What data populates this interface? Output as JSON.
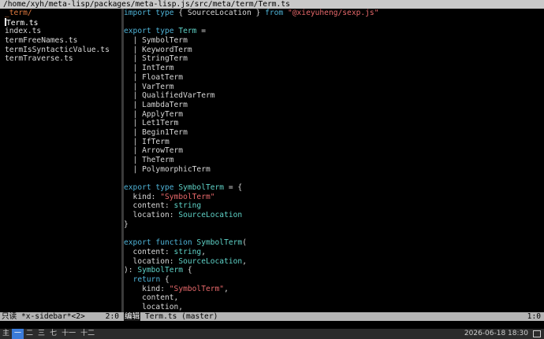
{
  "titlebar": {
    "path": "/home/xyh/meta-lisp/packages/meta-lisp.js/src/meta/term/Term.ts"
  },
  "sidebar": {
    "dir": "_term/",
    "files": [
      "Term.ts",
      "index.ts",
      "termFreeNames.ts",
      "termIsSyntacticValue.ts",
      "termTraverse.ts"
    ]
  },
  "editor": {
    "lines": [
      [
        {
          "c": "kw",
          "t": "import type"
        },
        {
          "c": "tx",
          "t": " { SourceLocation } "
        },
        {
          "c": "kw",
          "t": "from"
        },
        {
          "c": "tx",
          "t": " "
        },
        {
          "c": "str",
          "t": "\"@xieyuheng/sexp.js\""
        }
      ],
      [],
      [
        {
          "c": "kw",
          "t": "export type"
        },
        {
          "c": "tx",
          "t": " "
        },
        {
          "c": "ty",
          "t": "Term"
        },
        {
          "c": "tx",
          "t": " ="
        }
      ],
      [
        {
          "c": "tx",
          "t": "  | SymbolTerm"
        }
      ],
      [
        {
          "c": "tx",
          "t": "  | KeywordTerm"
        }
      ],
      [
        {
          "c": "tx",
          "t": "  | StringTerm"
        }
      ],
      [
        {
          "c": "tx",
          "t": "  | IntTerm"
        }
      ],
      [
        {
          "c": "tx",
          "t": "  | FloatTerm"
        }
      ],
      [
        {
          "c": "tx",
          "t": "  | VarTerm"
        }
      ],
      [
        {
          "c": "tx",
          "t": "  | QualifiedVarTerm"
        }
      ],
      [
        {
          "c": "tx",
          "t": "  | LambdaTerm"
        }
      ],
      [
        {
          "c": "tx",
          "t": "  | ApplyTerm"
        }
      ],
      [
        {
          "c": "tx",
          "t": "  | Let1Term"
        }
      ],
      [
        {
          "c": "tx",
          "t": "  | Begin1Term"
        }
      ],
      [
        {
          "c": "tx",
          "t": "  | IfTerm"
        }
      ],
      [
        {
          "c": "tx",
          "t": "  | ArrowTerm"
        }
      ],
      [
        {
          "c": "tx",
          "t": "  | TheTerm"
        }
      ],
      [
        {
          "c": "tx",
          "t": "  | PolymorphicTerm"
        }
      ],
      [],
      [
        {
          "c": "kw",
          "t": "export type"
        },
        {
          "c": "tx",
          "t": " "
        },
        {
          "c": "ty",
          "t": "SymbolTerm"
        },
        {
          "c": "tx",
          "t": " = {"
        }
      ],
      [
        {
          "c": "tx",
          "t": "  kind: "
        },
        {
          "c": "str",
          "t": "\"SymbolTerm\""
        }
      ],
      [
        {
          "c": "tx",
          "t": "  content: "
        },
        {
          "c": "ty",
          "t": "string"
        }
      ],
      [
        {
          "c": "tx",
          "t": "  location: "
        },
        {
          "c": "ty",
          "t": "SourceLocation"
        }
      ],
      [
        {
          "c": "tx",
          "t": "}"
        }
      ],
      [],
      [
        {
          "c": "kw",
          "t": "export function"
        },
        {
          "c": "tx",
          "t": " "
        },
        {
          "c": "ty",
          "t": "SymbolTerm"
        },
        {
          "c": "tx",
          "t": "("
        }
      ],
      [
        {
          "c": "tx",
          "t": "  content: "
        },
        {
          "c": "ty",
          "t": "string"
        },
        {
          "c": "tx",
          "t": ","
        }
      ],
      [
        {
          "c": "tx",
          "t": "  location: "
        },
        {
          "c": "ty",
          "t": "SourceLocation"
        },
        {
          "c": "tx",
          "t": ","
        }
      ],
      [
        {
          "c": "tx",
          "t": "): "
        },
        {
          "c": "ty",
          "t": "SymbolTerm"
        },
        {
          "c": "tx",
          "t": " {"
        }
      ],
      [
        {
          "c": "tx",
          "t": "  "
        },
        {
          "c": "kw",
          "t": "return"
        },
        {
          "c": "tx",
          "t": " {"
        }
      ],
      [
        {
          "c": "tx",
          "t": "    kind: "
        },
        {
          "c": "str",
          "t": "\"SymbolTerm\""
        },
        {
          "c": "tx",
          "t": ","
        }
      ],
      [
        {
          "c": "tx",
          "t": "    content,"
        }
      ],
      [
        {
          "c": "tx",
          "t": "    location,"
        }
      ]
    ]
  },
  "modeline_left": {
    "status": "只读",
    "buffer": "*x-sidebar*<2>",
    "pos": "2:0"
  },
  "modeline_right": {
    "badge": "编辑",
    "buffer": "Term.ts (master)",
    "pos": "1:0"
  },
  "taskbar": {
    "workspaces": [
      "主",
      "一",
      "二",
      "三",
      "七",
      "十一",
      "十二"
    ],
    "active_index": 1,
    "clock": "2026-06-18 18:30"
  },
  "colors": {
    "keyword": "#4fb4d8",
    "type": "#5fd3c8",
    "string": "#e8696b",
    "dir": "#e07a3f",
    "active_ws": "#3b7bd9"
  }
}
